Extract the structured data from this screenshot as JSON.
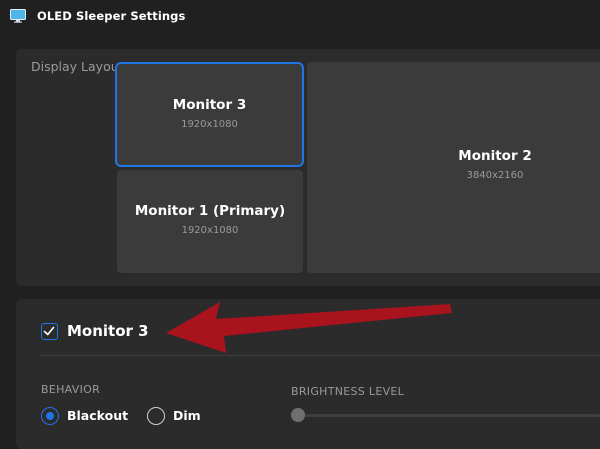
{
  "window": {
    "title": "OLED Sleeper Settings",
    "icon": "monitor-icon"
  },
  "display_layout": {
    "label": "Display Layout",
    "monitors": [
      {
        "name": "Monitor 3",
        "resolution": "1920x1080",
        "selected": true
      },
      {
        "name": "Monitor 1 (Primary)",
        "resolution": "1920x1080",
        "selected": false
      },
      {
        "name": "Monitor 2",
        "resolution": "3840x2160",
        "selected": false
      }
    ]
  },
  "monitor_settings": {
    "title": "Monitor 3",
    "enabled": true,
    "behavior": {
      "label": "BEHAVIOR",
      "options": [
        {
          "label": "Blackout",
          "selected": true
        },
        {
          "label": "Dim",
          "selected": false
        }
      ]
    },
    "brightness": {
      "label": "BRIGHTNESS LEVEL",
      "value_fraction": 0.0
    }
  },
  "colors": {
    "accent": "#1f74e6",
    "arrow": "#b0121c",
    "background": "#202020",
    "panel": "#2b2b2b"
  }
}
